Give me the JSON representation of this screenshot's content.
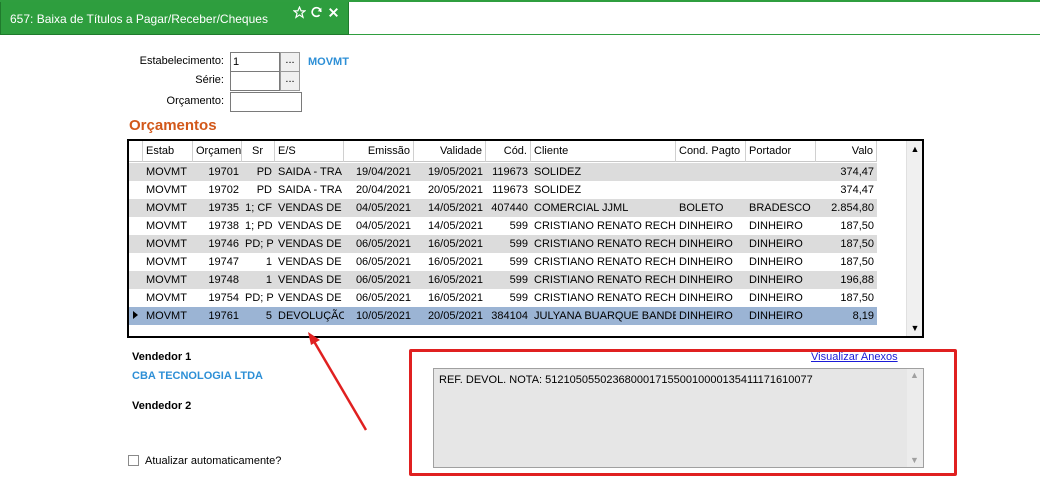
{
  "tab": {
    "title": "657: Baixa de Títulos a Pagar/Receber/Cheques",
    "icons": [
      "star-icon",
      "refresh-icon",
      "close-icon"
    ]
  },
  "form": {
    "estabelecimento_label": "Estabelecimento:",
    "estabelecimento_value": "1",
    "estabelecimento_desc": "MOVMT",
    "serie_label": "Série:",
    "serie_value": "",
    "orcamento_label": "Orçamento:",
    "orcamento_value": "",
    "lookup_button": "..."
  },
  "orcamentos": {
    "title": "Orçamentos",
    "columns": [
      "Estab",
      "Orçamen",
      "Sr",
      "E/S",
      "Emissão",
      "Validade",
      "Cód.",
      "Cliente",
      "Cond. Pagto",
      "Portador",
      "Valo"
    ],
    "rows": [
      {
        "estab": "MOVMT",
        "orc": "19701",
        "sr": "PD",
        "es": "SAIDA - TRA",
        "emissao": "19/04/2021",
        "validade": "19/05/2021",
        "cod": "119673",
        "cliente": "SOLIDEZ",
        "cond": "",
        "portador": "",
        "valor": "374,47"
      },
      {
        "estab": "MOVMT",
        "orc": "19702",
        "sr": "PD",
        "es": "SAIDA - TRA",
        "emissao": "20/04/2021",
        "validade": "20/05/2021",
        "cod": "119673",
        "cliente": "SOLIDEZ",
        "cond": "",
        "portador": "",
        "valor": "374,47"
      },
      {
        "estab": "MOVMT",
        "orc": "19735",
        "sr": "1; CF",
        "es": "VENDAS DE",
        "emissao": "04/05/2021",
        "validade": "14/05/2021",
        "cod": "407440",
        "cliente": "COMERCIAL JJML",
        "cond": "BOLETO",
        "portador": "BRADESCO",
        "valor": "2.854,80"
      },
      {
        "estab": "MOVMT",
        "orc": "19738",
        "sr": "1; PD",
        "es": "VENDAS DE",
        "emissao": "04/05/2021",
        "validade": "14/05/2021",
        "cod": "599",
        "cliente": "CRISTIANO RENATO RECH",
        "cond": "DINHEIRO",
        "portador": "DINHEIRO",
        "valor": "187,50"
      },
      {
        "estab": "MOVMT",
        "orc": "19746",
        "sr": "PD; P",
        "es": "VENDAS DE",
        "emissao": "06/05/2021",
        "validade": "16/05/2021",
        "cod": "599",
        "cliente": "CRISTIANO RENATO RECH",
        "cond": "DINHEIRO",
        "portador": "DINHEIRO",
        "valor": "187,50"
      },
      {
        "estab": "MOVMT",
        "orc": "19747",
        "sr": "1",
        "es": "VENDAS DE",
        "emissao": "06/05/2021",
        "validade": "16/05/2021",
        "cod": "599",
        "cliente": "CRISTIANO RENATO RECH",
        "cond": "DINHEIRO",
        "portador": "DINHEIRO",
        "valor": "187,50"
      },
      {
        "estab": "MOVMT",
        "orc": "19748",
        "sr": "1",
        "es": "VENDAS DE",
        "emissao": "06/05/2021",
        "validade": "16/05/2021",
        "cod": "599",
        "cliente": "CRISTIANO RENATO RECH",
        "cond": "DINHEIRO",
        "portador": "DINHEIRO",
        "valor": "196,88"
      },
      {
        "estab": "MOVMT",
        "orc": "19754",
        "sr": "PD; P",
        "es": "VENDAS DE",
        "emissao": "06/05/2021",
        "validade": "16/05/2021",
        "cod": "599",
        "cliente": "CRISTIANO RENATO RECH",
        "cond": "DINHEIRO",
        "portador": "DINHEIRO",
        "valor": "187,50"
      },
      {
        "estab": "MOVMT",
        "orc": "19761",
        "sr": "5",
        "es": "DEVOLUÇÃO",
        "emissao": "10/05/2021",
        "validade": "20/05/2021",
        "cod": "384104",
        "cliente": "JULYANA BUARQUE BANDE",
        "cond": "DINHEIRO",
        "portador": "DINHEIRO",
        "valor": "8,19"
      }
    ],
    "selected_index": 8
  },
  "vendedor": {
    "v1_label": "Vendedor 1",
    "v1_value": "CBA TECNOLOGIA LTDA",
    "v2_label": "Vendedor 2",
    "v2_value": ""
  },
  "atualizar": {
    "label": "Atualizar automaticamente?",
    "checked": false
  },
  "observacao": {
    "link": "Visualizar Anexos",
    "text": "REF. DEVOL. NOTA: 51210505502368000171550010000135411171610077"
  },
  "colors": {
    "tab_green": "#2e9e3e",
    "section_orange": "#d2581a",
    "link_blue": "#2d8fd6",
    "selected_row": "#9bb4d4",
    "highlight_red": "#e02020"
  }
}
